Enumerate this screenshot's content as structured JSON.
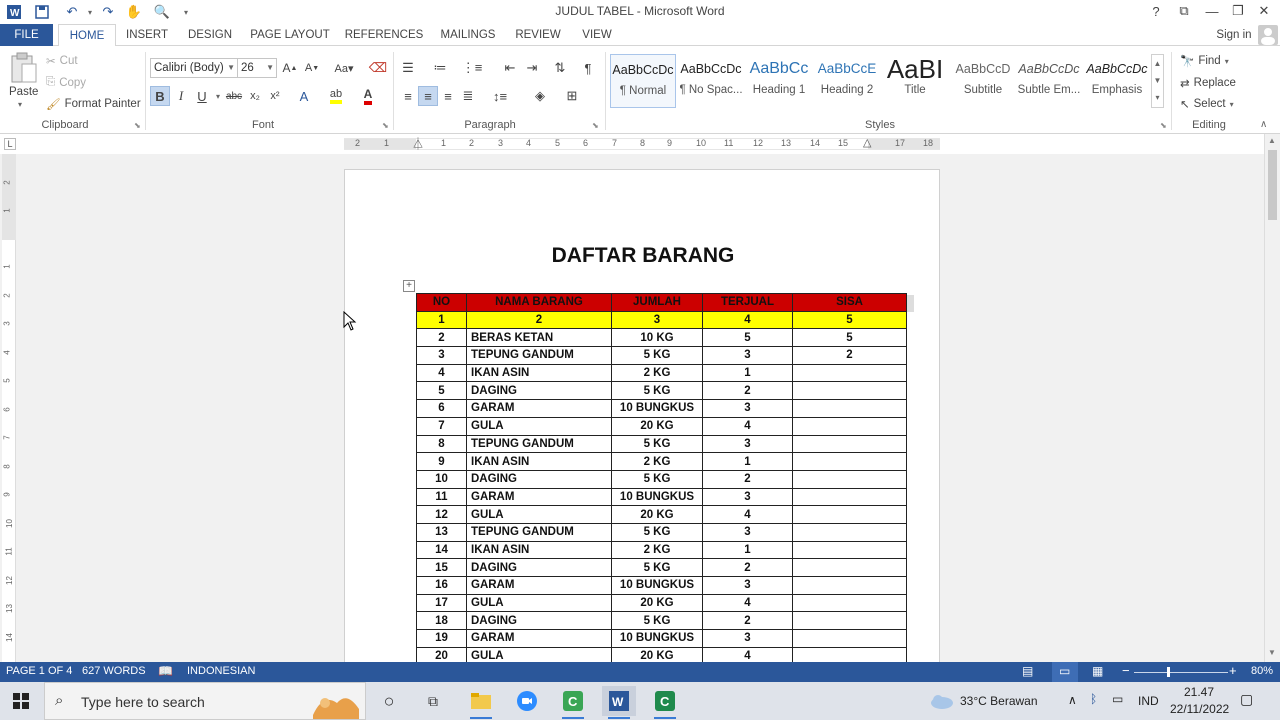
{
  "window": {
    "title": "JUDUL TABEL - Microsoft Word",
    "sign_in": "Sign in",
    "help": "?"
  },
  "tabs": [
    {
      "label": "FILE"
    },
    {
      "label": "HOME"
    },
    {
      "label": "INSERT"
    },
    {
      "label": "DESIGN"
    },
    {
      "label": "PAGE LAYOUT"
    },
    {
      "label": "REFERENCES"
    },
    {
      "label": "MAILINGS"
    },
    {
      "label": "REVIEW"
    },
    {
      "label": "VIEW"
    }
  ],
  "clipboard": {
    "paste": "Paste",
    "cut": "Cut",
    "copy": "Copy",
    "format_painter": "Format Painter",
    "group": "Clipboard"
  },
  "font": {
    "family": "Calibri (Body)",
    "size": "26",
    "group": "Font"
  },
  "paragraph": {
    "group": "Paragraph"
  },
  "styles": {
    "group": "Styles",
    "items": [
      {
        "sample": "AaBbCcDc",
        "name": "¶ Normal"
      },
      {
        "sample": "AaBbCcDc",
        "name": "¶ No Spac..."
      },
      {
        "sample": "AaBbCc",
        "name": "Heading 1"
      },
      {
        "sample": "AaBbCcE",
        "name": "Heading 2"
      },
      {
        "sample": "AaBI",
        "name": "Title"
      },
      {
        "sample": "AaBbCcD",
        "name": "Subtitle"
      },
      {
        "sample": "AaBbCcDc",
        "name": "Subtle Em..."
      },
      {
        "sample": "AaBbCcDc",
        "name": "Emphasis"
      }
    ]
  },
  "editing": {
    "find": "Find",
    "replace": "Replace",
    "select": "Select",
    "group": "Editing"
  },
  "ruler_numbers": [
    "2",
    "1",
    "1",
    "2",
    "3",
    "4",
    "5",
    "6",
    "7",
    "8",
    "9",
    "10",
    "11",
    "12",
    "13",
    "14",
    "15",
    "16",
    "17",
    "18"
  ],
  "vruler_numbers": [
    "2",
    "1",
    "1",
    "2",
    "3",
    "4",
    "5",
    "6",
    "7",
    "8",
    "9",
    "10",
    "11",
    "12",
    "13",
    "14"
  ],
  "document": {
    "title": "DAFTAR BARANG",
    "header": [
      "NO",
      "NAMA BARANG",
      "JUMLAH",
      "TERJUAL",
      "SISA"
    ],
    "number_row": [
      "1",
      "2",
      "3",
      "4",
      "5"
    ],
    "rows": [
      [
        "2",
        "BERAS KETAN",
        "10 KG",
        "5",
        "5"
      ],
      [
        "3",
        "TEPUNG GANDUM",
        "5 KG",
        "3",
        "2"
      ],
      [
        "4",
        "IKAN ASIN",
        "2 KG",
        "1",
        ""
      ],
      [
        "5",
        "DAGING",
        "5 KG",
        "2",
        ""
      ],
      [
        "6",
        "GARAM",
        "10 BUNGKUS",
        "3",
        ""
      ],
      [
        "7",
        "GULA",
        "20 KG",
        "4",
        ""
      ],
      [
        "8",
        "TEPUNG GANDUM",
        "5 KG",
        "3",
        ""
      ],
      [
        "9",
        "IKAN ASIN",
        "2 KG",
        "1",
        ""
      ],
      [
        "10",
        "DAGING",
        "5 KG",
        "2",
        ""
      ],
      [
        "11",
        "GARAM",
        "10 BUNGKUS",
        "3",
        ""
      ],
      [
        "12",
        "GULA",
        "20 KG",
        "4",
        ""
      ],
      [
        "13",
        "TEPUNG GANDUM",
        "5 KG",
        "3",
        ""
      ],
      [
        "14",
        "IKAN ASIN",
        "2 KG",
        "1",
        ""
      ],
      [
        "15",
        "DAGING",
        "5 KG",
        "2",
        ""
      ],
      [
        "16",
        "GARAM",
        "10 BUNGKUS",
        "3",
        ""
      ],
      [
        "17",
        "GULA",
        "20 KG",
        "4",
        ""
      ],
      [
        "18",
        "DAGING",
        "5 KG",
        "2",
        ""
      ],
      [
        "19",
        "GARAM",
        "10 BUNGKUS",
        "3",
        ""
      ],
      [
        "20",
        "GULA",
        "20 KG",
        "4",
        ""
      ]
    ]
  },
  "status": {
    "page": "PAGE 1 OF 4",
    "words": "627 WORDS",
    "language": "INDONESIAN",
    "zoom": "80%"
  },
  "taskbar": {
    "search_placeholder": "Type here to search",
    "weather": "33°C  Berawan",
    "lang": "IND",
    "time": "21.47",
    "date": "22/11/2022"
  },
  "colors": {
    "word_blue": "#2b579a",
    "header_red": "#cc0000",
    "number_yellow": "#ffff00"
  }
}
